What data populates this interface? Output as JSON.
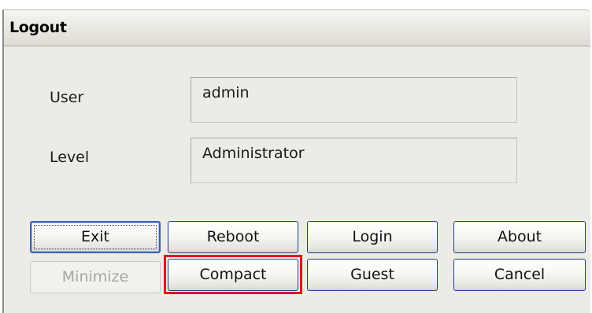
{
  "window": {
    "title": "Logout"
  },
  "form": {
    "user_label": "User",
    "user_value": "admin",
    "level_label": "Level",
    "level_value": "Administrator"
  },
  "buttons": {
    "exit": "Exit",
    "reboot": "Reboot",
    "login": "Login",
    "about": "About",
    "minimize": "Minimize",
    "compact": "Compact",
    "guest": "Guest",
    "cancel": "Cancel"
  },
  "states": {
    "minimize_enabled": false,
    "default_button": "Exit",
    "highlighted_button": "Compact"
  },
  "colors": {
    "highlight": "#e3121e",
    "dialog_background": "#ecebe5",
    "button_border": "#1e3f87"
  }
}
